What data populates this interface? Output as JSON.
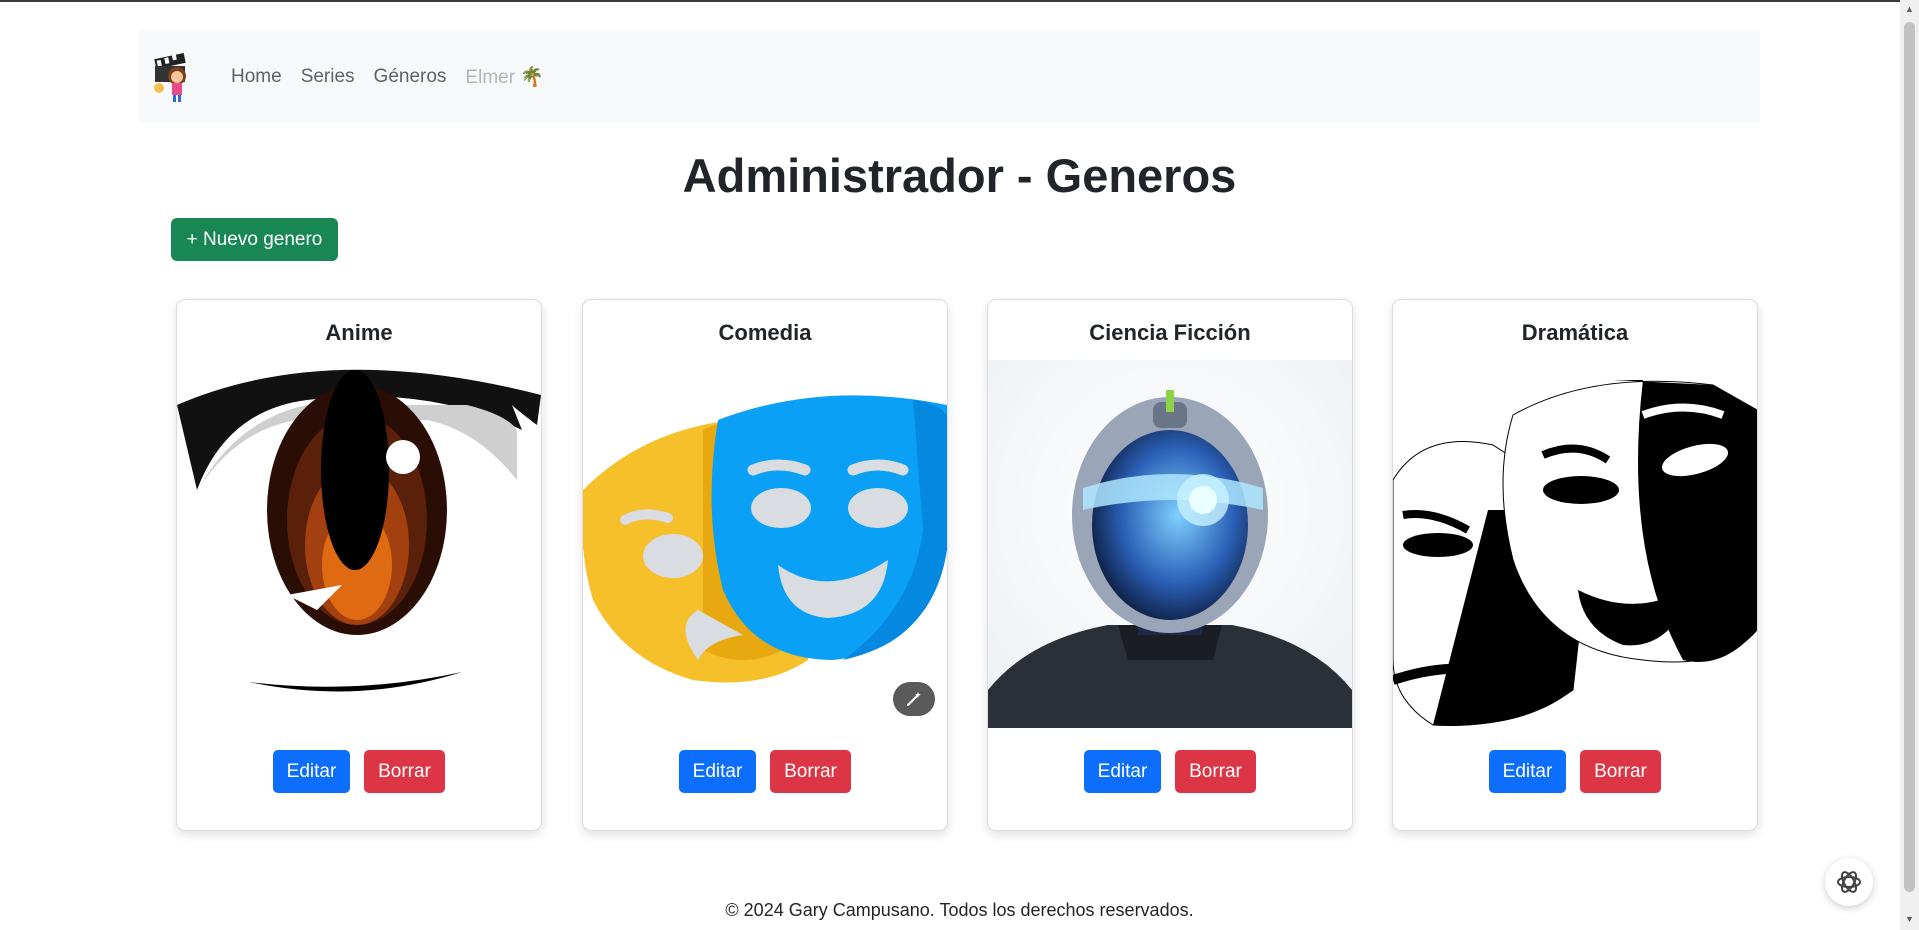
{
  "navbar": {
    "links": [
      "Home",
      "Series",
      "Géneros"
    ],
    "user": "Elmer 🌴"
  },
  "page": {
    "title": "Administrador - Generos",
    "new_button": "+ Nuevo genero"
  },
  "genres": [
    {
      "title": "Anime",
      "icon": "anime-eye-image"
    },
    {
      "title": "Comedia",
      "icon": "comedy-masks-image"
    },
    {
      "title": "Ciencia Ficción",
      "icon": "scifi-robot-image"
    },
    {
      "title": "Dramática",
      "icon": "drama-masks-image"
    }
  ],
  "actions": {
    "edit": "Editar",
    "delete": "Borrar"
  },
  "footer": "© 2024 Gary Campusano. Todos los derechos reservados.",
  "colors": {
    "success": "#198754",
    "primary": "#0d6efd",
    "danger": "#dc3545",
    "navbar_bg": "#f8f9fa"
  }
}
